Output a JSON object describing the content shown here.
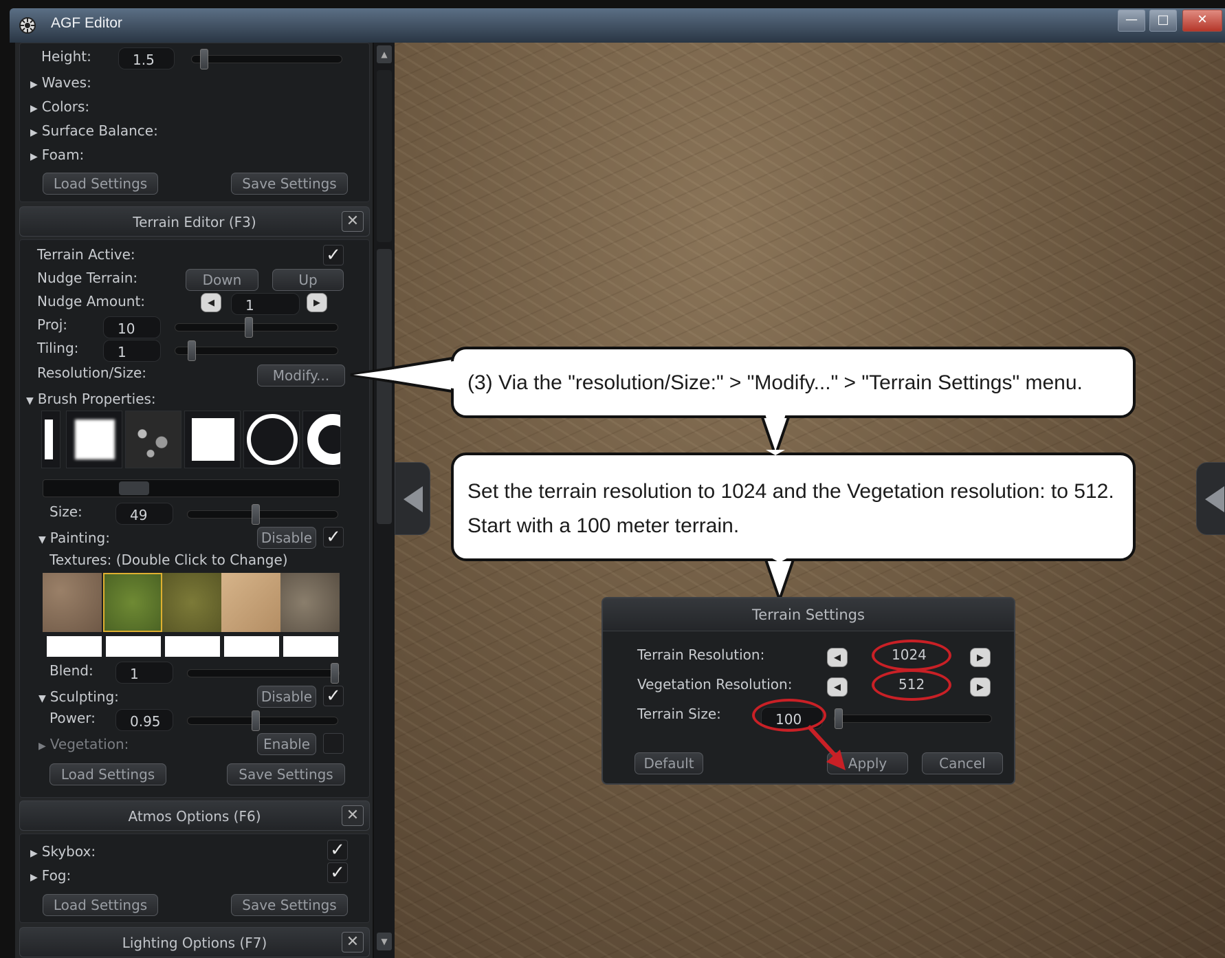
{
  "window": {
    "title": "AGF Editor",
    "min": "—",
    "max": "□",
    "close": "✕"
  },
  "water": {
    "height_label": "Height:",
    "height_value": "1.5",
    "height_level": 0.06,
    "items": [
      "Waves:",
      "Colors:",
      "Surface Balance:",
      "Foam:"
    ],
    "load": "Load Settings",
    "save": "Save Settings"
  },
  "terrain_editor": {
    "title": "Terrain Editor (F3)",
    "close": "✕",
    "terrain_active_label": "Terrain Active:",
    "terrain_active": true,
    "nudge_terrain_label": "Nudge Terrain:",
    "down": "Down",
    "up": "Up",
    "nudge_amount_label": "Nudge Amount:",
    "nudge_amount": "1",
    "proj_label": "Proj:",
    "proj_value": "10",
    "proj_level": 0.45,
    "tiling_label": "Tiling:",
    "tiling_value": "1",
    "tiling_level": 0.08,
    "resolution_label": "Resolution/Size:",
    "modify": "Modify...",
    "brush_label": "Brush Properties:",
    "size_label": "Size:",
    "size_value": "49",
    "size_level": 0.45,
    "painting_label": "Painting:",
    "painting_disable": "Disable",
    "painting_checked": true,
    "textures_label": "Textures: (Double Click to Change)",
    "blend_label": "Blend:",
    "blend_value": "1",
    "blend_level": 1.0,
    "sculpting_label": "Sculpting:",
    "sculpting_disable": "Disable",
    "sculpting_checked": true,
    "power_label": "Power:",
    "power_value": "0.95",
    "power_level": 0.45,
    "vegetation_label": "Vegetation:",
    "vegetation_enable": "Enable",
    "load": "Load Settings",
    "save": "Save Settings"
  },
  "atmos": {
    "title": "Atmos Options (F6)",
    "close": "✕",
    "skybox": "Skybox:",
    "fog": "Fog:",
    "load": "Load Settings",
    "save": "Save Settings"
  },
  "lighting": {
    "title": "Lighting Options (F7)",
    "close": "✕"
  },
  "callout1": {
    "text": "(3) Via the \"resolution/Size:\" > \"Modify...\" > \"Terrain Settings\" menu."
  },
  "callout2": {
    "line1": "Set the terrain resolution to 1024 and the Vegetation resolution: to 512.",
    "line2": "Start with a 100 meter terrain."
  },
  "terrain_settings": {
    "title": "Terrain Settings",
    "terrain_res_label": "Terrain Resolution:",
    "terrain_res": "1024",
    "veg_res_label": "Vegetation Resolution:",
    "veg_res": "512",
    "size_label": "Terrain Size:",
    "size": "100",
    "size_level": 0.0,
    "default": "Default",
    "apply": "Apply",
    "cancel": "Cancel"
  },
  "colors": {
    "highlight": "#c92026",
    "panel": "#252729",
    "accent_texture": "#e0b030"
  }
}
